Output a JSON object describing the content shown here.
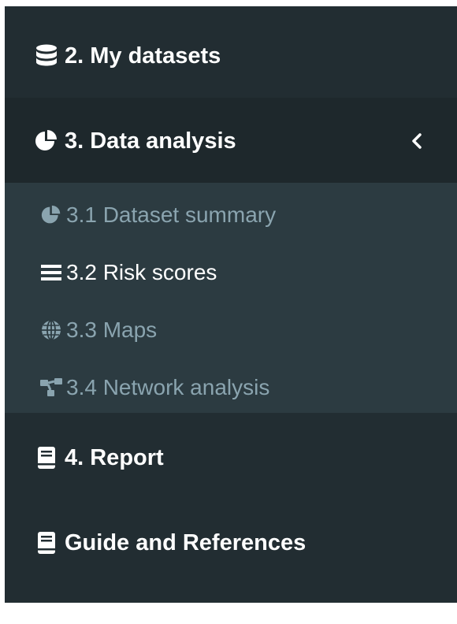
{
  "sidebar": {
    "items": [
      {
        "label": "2. My datasets",
        "icon": "database-icon"
      },
      {
        "label": "3. Data analysis",
        "icon": "pie-chart-icon",
        "expanded": true
      },
      {
        "label": "4. Report",
        "icon": "book-icon"
      },
      {
        "label": "Guide and References",
        "icon": "book-icon"
      }
    ],
    "submenu": [
      {
        "label": "3.1 Dataset summary",
        "icon": "pie-chart-icon",
        "active": false
      },
      {
        "label": "3.2 Risk scores",
        "icon": "bars-icon",
        "active": true
      },
      {
        "label": "3.3 Maps",
        "icon": "globe-icon",
        "active": false
      },
      {
        "label": "3.4 Network analysis",
        "icon": "sitemap-icon",
        "active": false
      }
    ]
  },
  "colors": {
    "sidebar_bg": "#222d32",
    "active_header_bg": "#1e282c",
    "submenu_bg": "#2c3b41",
    "submenu_text": "#8aa4af",
    "active_text": "#ffffff"
  }
}
